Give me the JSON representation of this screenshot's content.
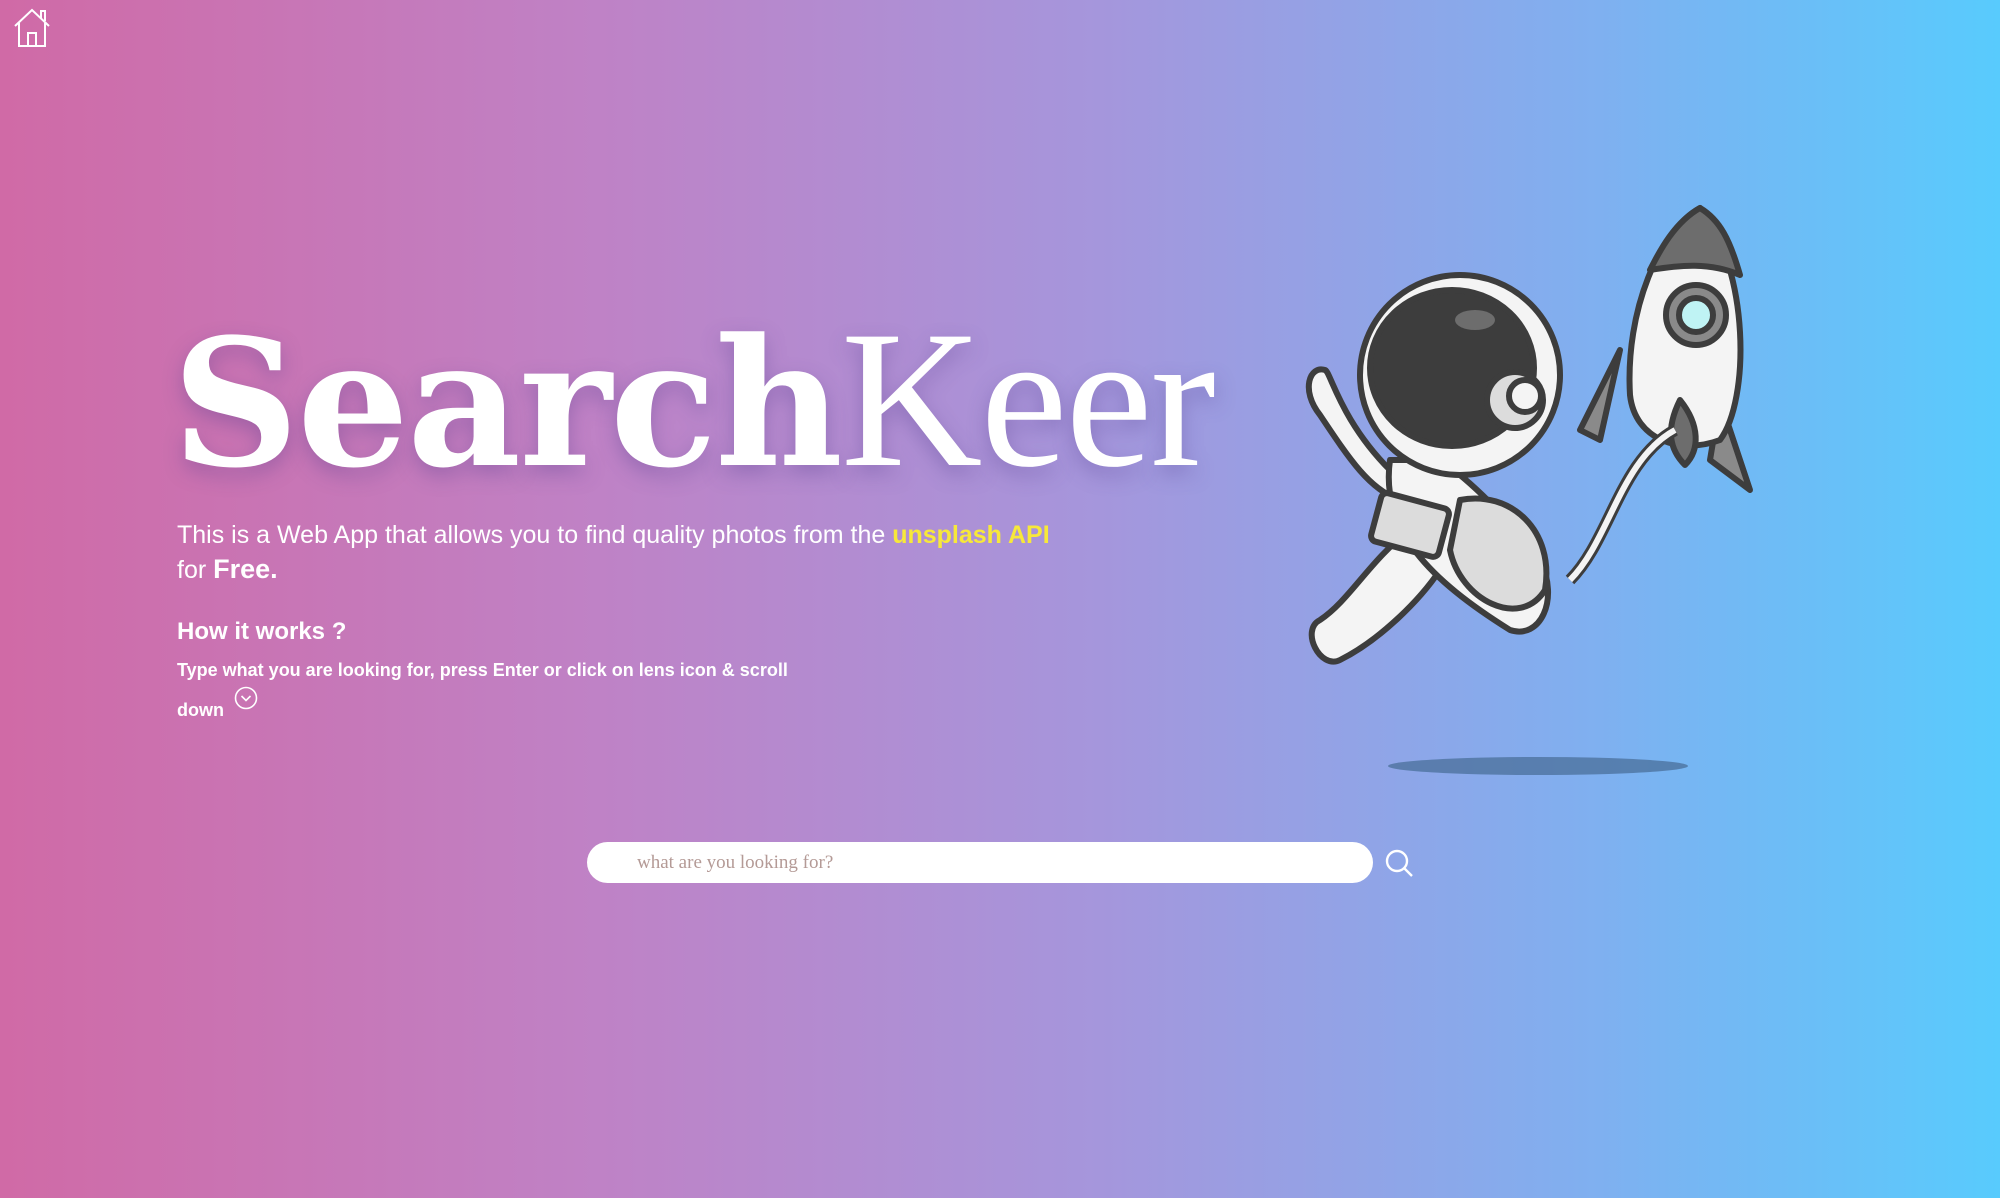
{
  "nav": {
    "home_icon": "home-icon"
  },
  "hero": {
    "title_bold": "Search",
    "title_light": "Keer",
    "subtitle_pre": "This is a Web App that allows you to find quality photos from the ",
    "subtitle_link": "unsplash API",
    "subtitle_mid": " for ",
    "subtitle_free": "Free.",
    "how_title": "How it works ?",
    "how_text": "Type what you are looking for, press Enter or click on lens icon & scroll down"
  },
  "search": {
    "placeholder": "what are you looking for?",
    "value": "",
    "icon": "search-icon"
  },
  "colors": {
    "gradient_start": "#d06aa6",
    "gradient_end": "#58cbfd",
    "highlight": "#f7e83a"
  }
}
